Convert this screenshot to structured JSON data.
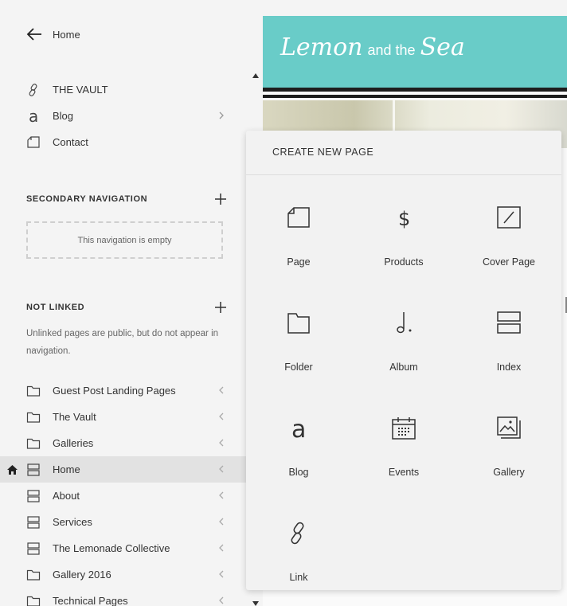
{
  "sidebar": {
    "back_label": "Home",
    "main_nav": [
      {
        "label": "THE VAULT",
        "icon": "link-icon",
        "chevron": false
      },
      {
        "label": "Blog",
        "icon": "blog-icon",
        "chevron": true
      },
      {
        "label": "Contact",
        "icon": "page-icon",
        "chevron": false
      }
    ],
    "secondary_title": "SECONDARY NAVIGATION",
    "secondary_empty": "This navigation is empty",
    "not_linked_title": "NOT LINKED",
    "not_linked_note": "Unlinked pages are public, but do not appear in navigation.",
    "not_linked_items": [
      {
        "label": "Guest Post Landing Pages",
        "icon": "folder-icon"
      },
      {
        "label": "The Vault",
        "icon": "folder-icon"
      },
      {
        "label": "Galleries",
        "icon": "folder-icon"
      },
      {
        "label": "Home",
        "icon": "index-icon",
        "active": true
      },
      {
        "label": "About",
        "icon": "index-icon"
      },
      {
        "label": "Services",
        "icon": "index-icon"
      },
      {
        "label": "The Lemonade Collective",
        "icon": "index-icon"
      },
      {
        "label": "Gallery 2016",
        "icon": "folder-icon"
      },
      {
        "label": "Technical Pages",
        "icon": "folder-icon"
      }
    ]
  },
  "preview": {
    "logo_part1": "Lemon",
    "logo_part2": "and the",
    "logo_part3": "Sea",
    "banner_color": "#69ccc8"
  },
  "create_panel": {
    "title": "CREATE NEW PAGE",
    "tiles": [
      {
        "label": "Page",
        "icon": "page-icon"
      },
      {
        "label": "Products",
        "icon": "dollar-icon"
      },
      {
        "label": "Cover Page",
        "icon": "cover-page-icon"
      },
      {
        "label": "Folder",
        "icon": "folder-icon"
      },
      {
        "label": "Album",
        "icon": "music-note-icon"
      },
      {
        "label": "Index",
        "icon": "index-icon"
      },
      {
        "label": "Blog",
        "icon": "blog-icon"
      },
      {
        "label": "Events",
        "icon": "calendar-icon"
      },
      {
        "label": "Gallery",
        "icon": "gallery-icon"
      },
      {
        "label": "Link",
        "icon": "link-icon"
      }
    ]
  }
}
